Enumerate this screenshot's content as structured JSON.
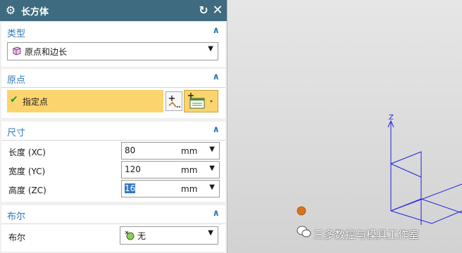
{
  "dialog": {
    "title": "长方体",
    "icons": {
      "settings": "gear-icon",
      "reset": "reset-icon",
      "close": "close-icon"
    }
  },
  "type_section": {
    "label": "类型",
    "selected": "原点和边长"
  },
  "origin_section": {
    "label": "原点",
    "specify_point_label": "指定点"
  },
  "dimensions_section": {
    "label": "尺寸",
    "rows": [
      {
        "label": "长度 (XC)",
        "value": "80",
        "unit": "mm"
      },
      {
        "label": "宽度 (YC)",
        "value": "120",
        "unit": "mm"
      },
      {
        "label": "高度 (ZC)",
        "value": "16",
        "unit": "mm"
      }
    ]
  },
  "boolean_section": {
    "label": "布尔",
    "row_label": "布尔",
    "selected": "无"
  },
  "viewport": {
    "axis_z_label": "Z",
    "watermark": "三多数控与模具工作室"
  },
  "colors": {
    "titlebar": "#3e6b80",
    "section_label": "#2e78b8",
    "highlight": "#fbd46e",
    "axis": "#1e22e0",
    "origin_ball": "#d9721a"
  }
}
